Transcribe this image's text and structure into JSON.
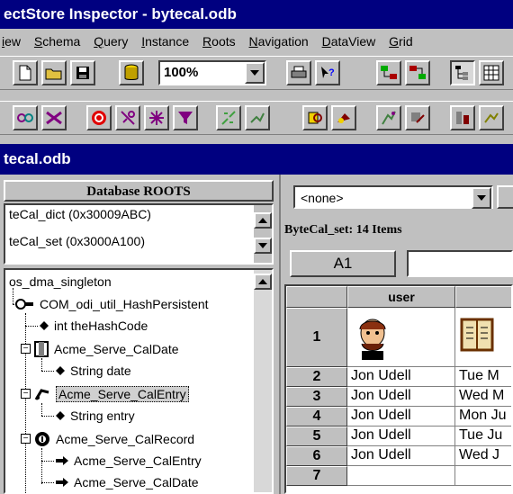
{
  "window": {
    "title": "ectStore Inspector - bytecal.odb"
  },
  "menu": [
    "iew",
    "Schema",
    "Query",
    "Instance",
    "Roots",
    "Navigation",
    "DataView",
    "Grid"
  ],
  "toolbar": {
    "zoom_value": "100%"
  },
  "document": {
    "title": "tecal.odb"
  },
  "roots": {
    "header": "Database ROOTS",
    "items": [
      "teCal_dict (0x30009ABC)",
      "teCal_set (0x3000A100)"
    ]
  },
  "tree": {
    "nodes": [
      "os_dma_singleton",
      "COM_odi_util_HashPersistent",
      "int theHashCode",
      "Acme_Serve_CalDate",
      "String date",
      "Acme_Serve_CalEntry",
      "String entry",
      "Acme_Serve_CalRecord",
      "Acme_Serve_CalEntry",
      "Acme_Serve_CalDate"
    ]
  },
  "class_selector": {
    "value": "<none>"
  },
  "set_caption": "ByteCal_set: 14 Items",
  "cell_ref": "A1",
  "grid": {
    "columns": [
      "user",
      ""
    ],
    "rows": [
      {
        "num": "1",
        "user": "",
        "date": ""
      },
      {
        "num": "2",
        "user": "Jon Udell",
        "date": "Tue M"
      },
      {
        "num": "3",
        "user": "Jon Udell",
        "date": "Wed M"
      },
      {
        "num": "4",
        "user": "Jon Udell",
        "date": "Mon Ju"
      },
      {
        "num": "5",
        "user": "Jon Udell",
        "date": "Tue Ju"
      },
      {
        "num": "6",
        "user": "Jon Udell",
        "date": "Wed J"
      },
      {
        "num": "7",
        "user": "",
        "date": ""
      }
    ]
  },
  "colors": {
    "titlebar": "#000080",
    "face": "#c0c0c0",
    "highlight": "#ffffff",
    "shadow": "#404040"
  }
}
